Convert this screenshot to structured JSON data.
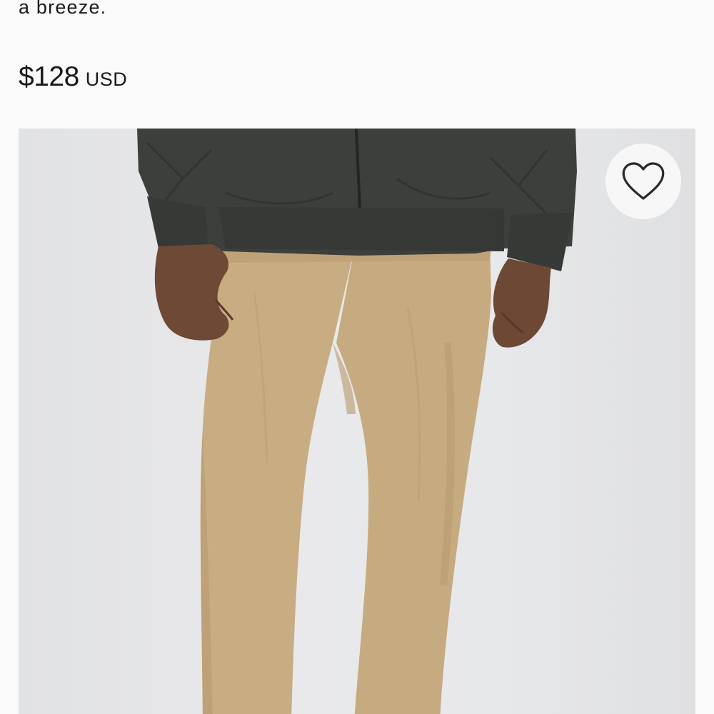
{
  "product": {
    "description_tail": "a breeze.",
    "price": {
      "amount": "$128",
      "currency": "USD"
    },
    "image": {
      "alt": "Man wearing khaki pants and dark green quilted jacket"
    },
    "wishlist": {
      "icon": "heart-outline-icon",
      "label": "Add to wish list"
    }
  },
  "colors": {
    "background": "#fafafa",
    "text": "#1a1a1a",
    "image_background": "#e8e9eb",
    "pants": "#c8ae84",
    "jacket": "#3b3e3a"
  }
}
